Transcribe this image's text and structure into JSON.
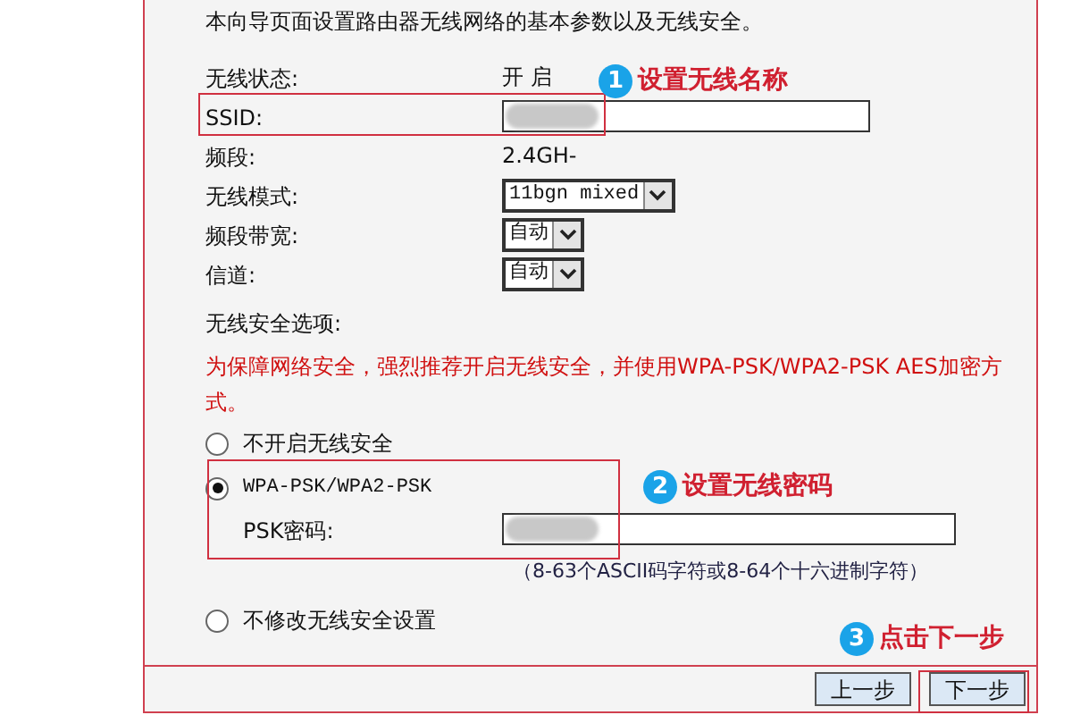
{
  "intro": "本向导页面设置路由器无线网络的基本参数以及无线安全。",
  "fields": [
    {
      "kind": "text",
      "label": "无线状态:",
      "value": "开 启"
    },
    {
      "kind": "input",
      "label": "SSID:",
      "redacted": true
    },
    {
      "kind": "text",
      "label": "频段:",
      "value": "2.4GH-"
    },
    {
      "kind": "select",
      "label": "无线模式:",
      "value": "11bgn mixed"
    },
    {
      "kind": "select",
      "label": "频段带宽:",
      "value": "自动"
    },
    {
      "kind": "select",
      "label": "信道:",
      "value": "自动"
    }
  ],
  "security": {
    "heading": "无线安全选项:",
    "warning": "为保障网络安全，强烈推荐开启无线安全，并使用WPA-PSK/WPA2-PSK AES加密方式。",
    "options": [
      {
        "label": "不开启无线安全",
        "selected": false
      },
      {
        "label": "WPA-PSK/WPA2-PSK",
        "selected": true,
        "password_label": "PSK密码:",
        "redacted": true,
        "hint": "（8-63个ASCII码字符或8-64个十六进制字符）"
      },
      {
        "label": "不修改无线安全设置",
        "selected": false
      }
    ]
  },
  "annotations": [
    {
      "number": "1",
      "text": "设置无线名称"
    },
    {
      "number": "2",
      "text": "设置无线密码"
    },
    {
      "number": "3",
      "text": "点击下一步"
    }
  ],
  "buttons": [
    "上一步",
    "下一步"
  ]
}
